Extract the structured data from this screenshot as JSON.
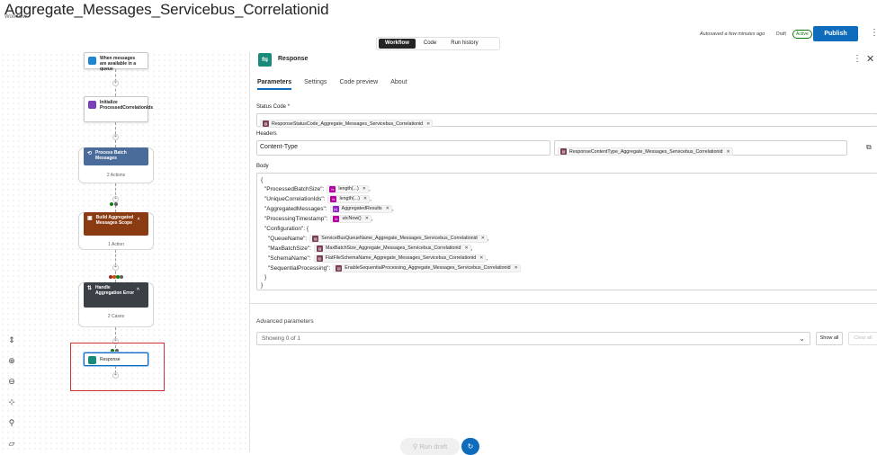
{
  "header": {
    "title": "Aggregate_Messages_Servicebus_Correlationid",
    "subtitle": "Workflow",
    "more_icon": "more-horizontal-icon",
    "tabs": [
      {
        "label": "Workflow",
        "active": true
      },
      {
        "label": "Code",
        "active": false
      },
      {
        "label": "Run history",
        "active": false
      }
    ],
    "autosave": "Autosaved a few minutes ago",
    "draft": "Draft",
    "status": "Active",
    "publish": "Publish"
  },
  "designer": {
    "trigger": "When messages are available in a queue",
    "init": "Initialize ProcessedCorrelationIds",
    "process": {
      "label": "Process Batch Messages",
      "count": "2 Actions",
      "color": "#4a6c9b"
    },
    "build": {
      "label": "Build Aggregated Messages Scope",
      "count": "1 Action",
      "color": "#8a3b12"
    },
    "handle": {
      "label": "Handle Aggregation Error",
      "count": "2 Cases",
      "color": "#3b3f46"
    },
    "response": "Response",
    "controls": [
      "fit-view-icon",
      "zoom-in-icon",
      "zoom-out-icon",
      "center-icon",
      "search-icon",
      "minimap-icon"
    ]
  },
  "panel": {
    "title": "Response",
    "tabs": [
      "Parameters",
      "Settings",
      "Code preview",
      "About"
    ],
    "status_label": "Status Code *",
    "status_token": "ResponseStatusCode_Aggregate_Messages_Servicebus_Correlationid",
    "headers_label": "Headers",
    "header_key": "Content-Type",
    "header_token": "ResponseContentType_Aggregate_Messages_Servicebus_Correlationid",
    "body_label": "Body",
    "body": {
      "open": "{",
      "l1": "\"ProcessedBatchSize\":",
      "t1": "length(...)",
      "l2": "\"UniqueCorrelationIds\":",
      "t2": "length(...)",
      "l3": "\"AggregatedMessages\":",
      "t3": "AggregatedResults",
      "l4": "\"ProcessingTimestamp\":",
      "t4": "utcNow()",
      "l5": "\"Configuration\": {",
      "l6": "\"QueueName\":",
      "t6": "ServiceBusQueueName_Aggregate_Messages_Servicebus_Correlationid",
      "l7": "\"MaxBatchSize\":",
      "t7": "MaxBatchSize_Aggregate_Messages_Servicebus_Correlationid",
      "l8": "\"SchemaName\":",
      "t8": "FlatFileSchemaName_Aggregate_Messages_Servicebus_Correlationid",
      "l9": "\"SequentialProcessing\":",
      "t9": "EnableSequentialProcessing_Aggregate_Messages_Servicebus_Correlationid",
      "close_inner": "}",
      "close": "}"
    },
    "advanced_label": "Advanced parameters",
    "advanced_value": "Showing 0 of 1",
    "show_all": "Show all",
    "clear_all": "Clear all",
    "run_draft": "Run draft"
  },
  "colors": {
    "accent": "#0f6cbd",
    "param_token": "#7a3e56",
    "expr_token": "#b4009e",
    "var_token": "#8e1fc7",
    "highlight": "#d13438"
  }
}
